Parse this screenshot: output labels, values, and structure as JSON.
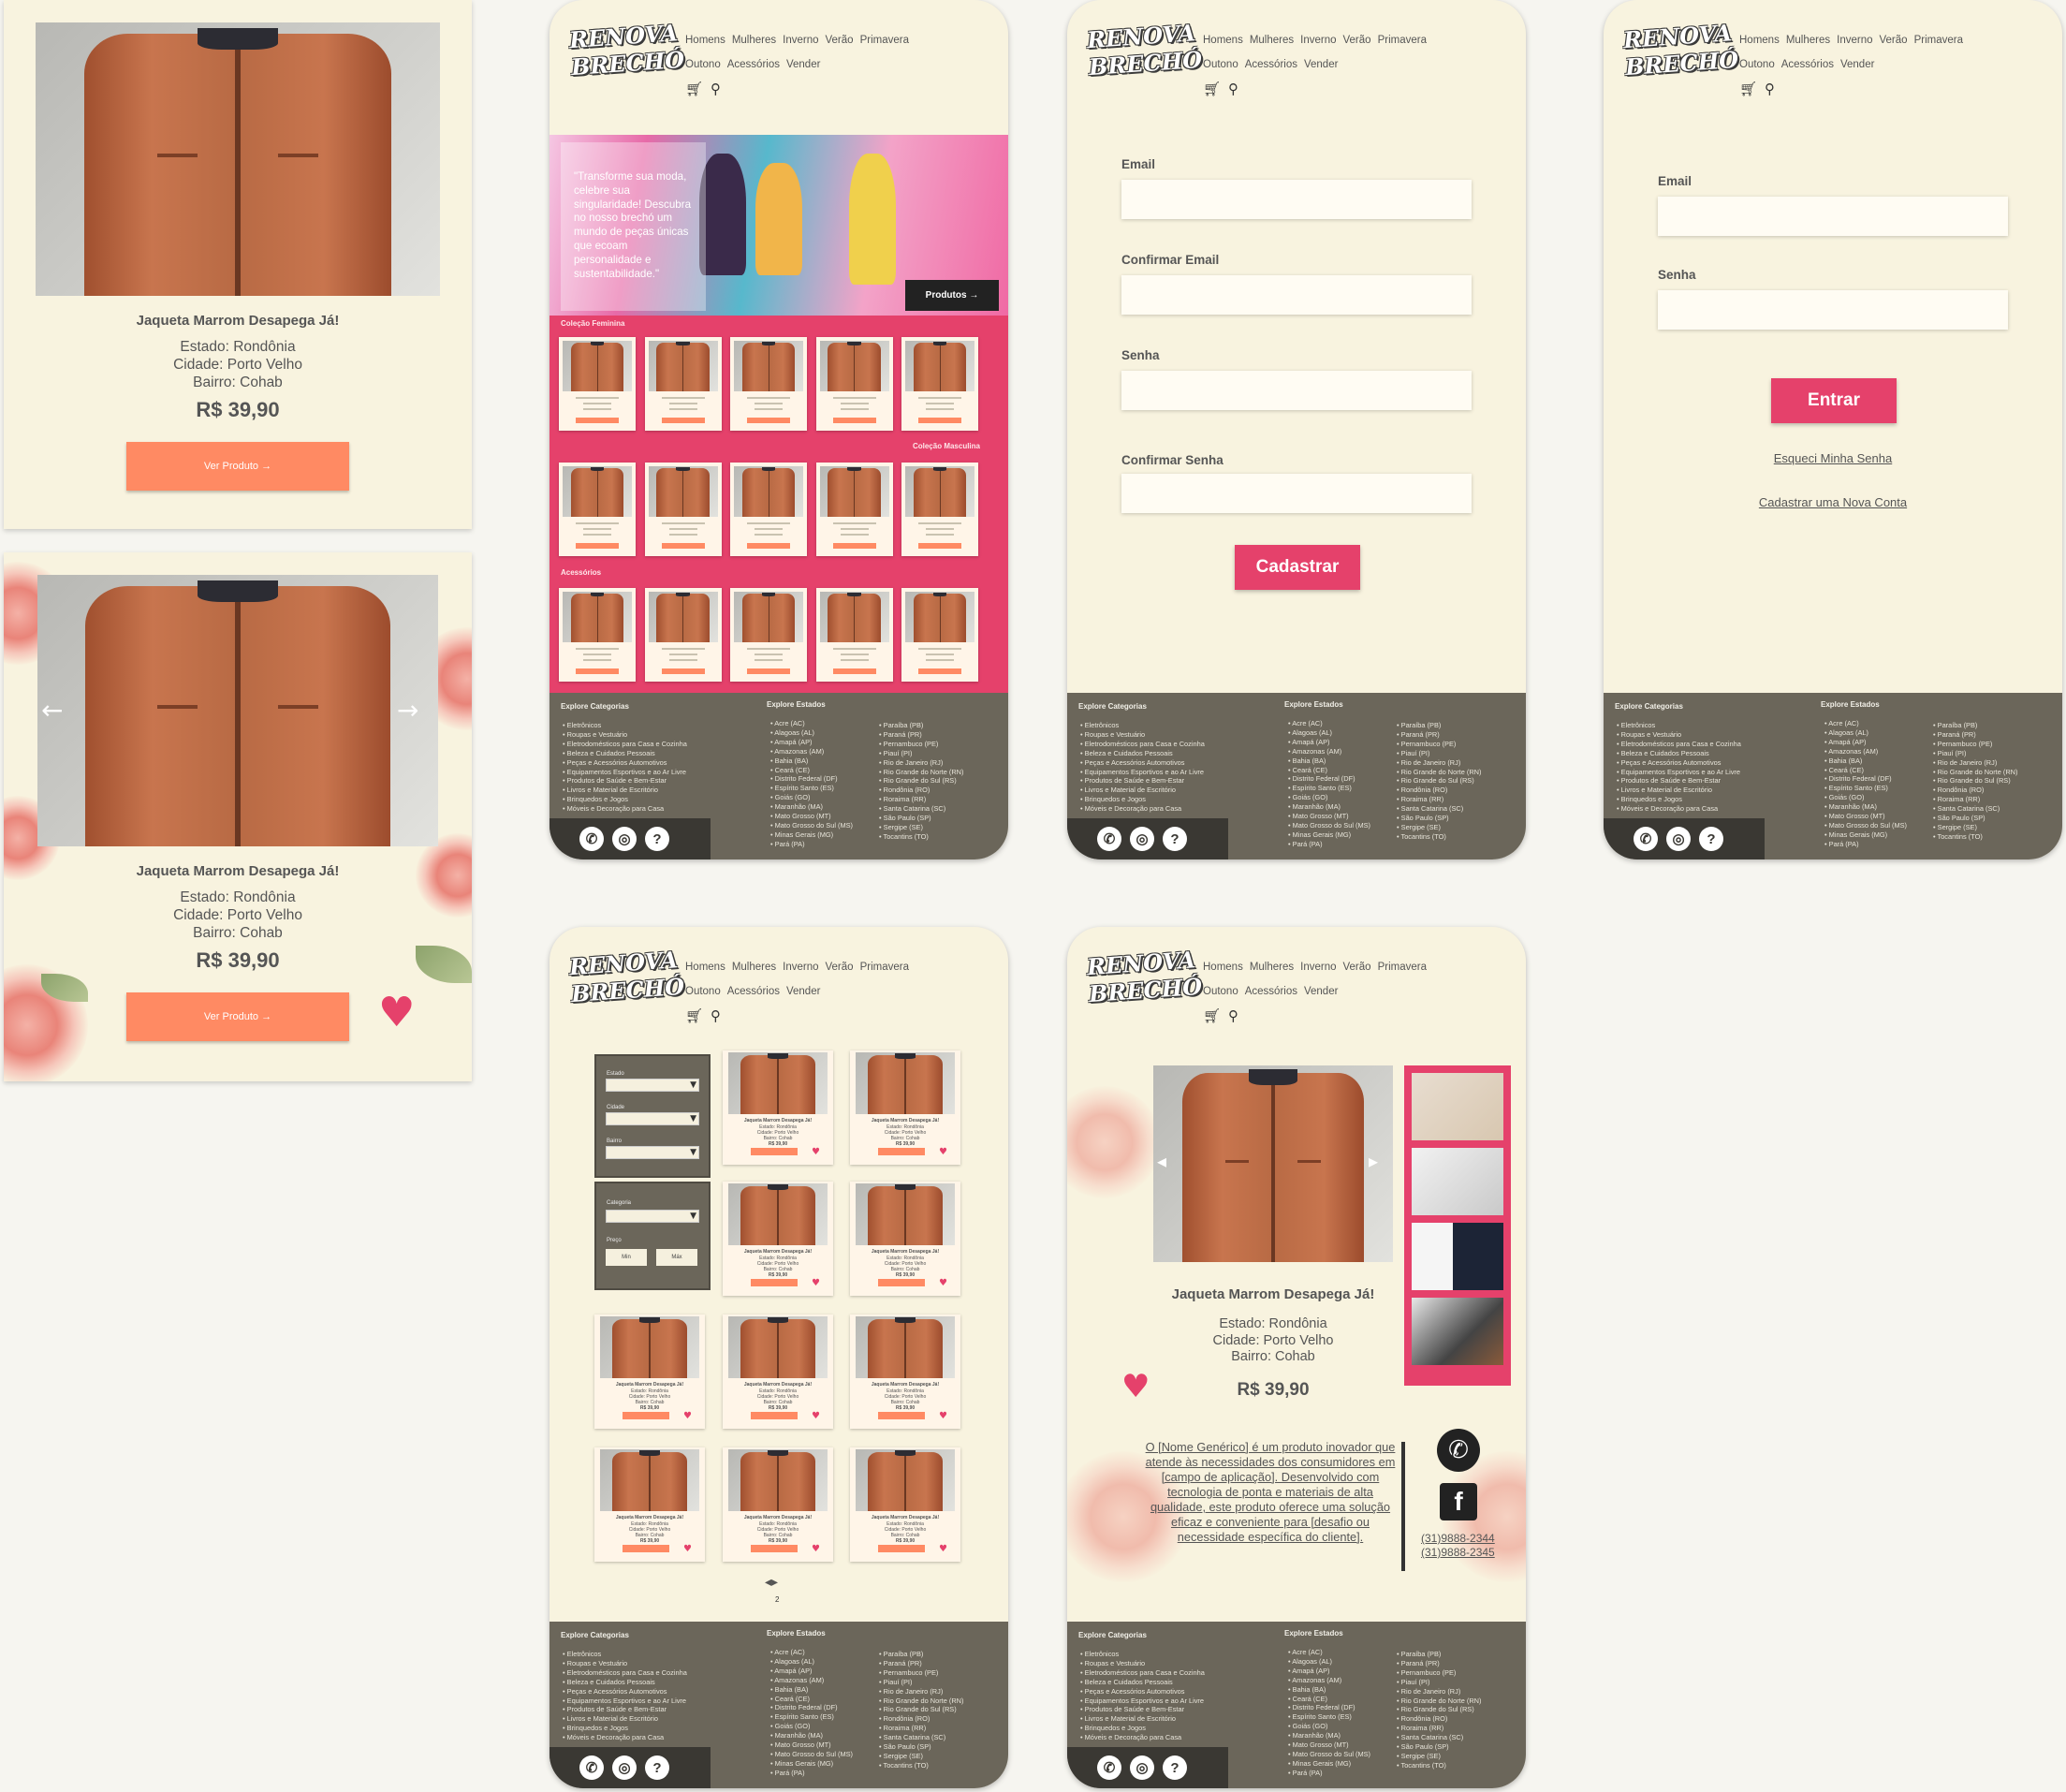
{
  "product": {
    "title": "Jaqueta Marrom Desapega Já!",
    "estado": "Estado: Rondônia",
    "cidade": "Cidade: Porto Velho",
    "bairro": "Bairro: Cohab",
    "price": "R$ 39,90",
    "view_button": "Ver Produto →",
    "description": "O [Nome Genérico] é um produto inovador que atende às necessidades dos consumidores em [campo de aplicação]. Desenvolvido com tecnologia de ponta e materiais de alta qualidade, este produto oferece uma solução eficaz e conveniente para [desafio ou necessidade específica do cliente].",
    "phone1": "(31)9888-2344",
    "phone2": "(31)9888-2345"
  },
  "brand": {
    "line1": "RENOVA",
    "line2": "BRECHÓ"
  },
  "nav": {
    "row1": [
      "Homens",
      "Mulheres",
      "Inverno",
      "Verão",
      "Primavera"
    ],
    "row2": [
      "Outono",
      "Acessórios",
      "Vender"
    ]
  },
  "hero": {
    "quote": "\"Transforme sua moda, celebre sua singularidade! Descubra no nosso brechó um mundo de peças únicas que ecoam personalidade e sustentabilidade.\"",
    "button": "Produtos →"
  },
  "sections": {
    "feminina": "Coleção Feminina",
    "masculina": "Coleção Masculina",
    "acessorios": "Acessórios"
  },
  "register": {
    "email": "Email",
    "confirm_email": "Confirmar Email",
    "password": "Senha",
    "confirm_password": "Confirmar Senha",
    "submit": "Cadastrar"
  },
  "login": {
    "email": "Email",
    "password": "Senha",
    "submit": "Entrar",
    "forgot": "Esqueci Minha Senha",
    "create": "Cadastrar uma Nova Conta"
  },
  "filters": {
    "estado": "Estado",
    "cidade": "Cidade",
    "bairro": "Bairro",
    "categoria": "Categoria",
    "preco": "Preço",
    "min": "Min",
    "max": "Máx"
  },
  "pagination": {
    "page": "2"
  },
  "footer": {
    "categories_title": "Explore Categorias",
    "states_title": "Explore Estados",
    "categories": [
      "Eletrônicos",
      "Roupas e Vestuário",
      "Eletrodomésticos para Casa e Cozinha",
      "Beleza e Cuidados Pessoais",
      "Peças e Acessórios Automotivos",
      "Equipamentos Esportivos e ao Ar Livre",
      "Produtos de Saúde e Bem-Estar",
      "Livros e Material de Escritório",
      "Brinquedos e Jogos",
      "Móveis e Decoração para Casa"
    ],
    "states_a": [
      "Acre (AC)",
      "Alagoas (AL)",
      "Amapá (AP)",
      "Amazonas (AM)",
      "Bahia (BA)",
      "Ceará (CE)",
      "Distrito Federal (DF)",
      "Espírito Santo (ES)",
      "Goiás (GO)",
      "Maranhão (MA)",
      "Mato Grosso (MT)",
      "Mato Grosso do Sul (MS)",
      "Minas Gerais (MG)",
      "Pará (PA)"
    ],
    "states_b": [
      "Paraíba (PB)",
      "Paraná (PR)",
      "Pernambuco (PE)",
      "Piauí (PI)",
      "Rio de Janeiro (RJ)",
      "Rio Grande do Norte (RN)",
      "Rio Grande do Sul (RS)",
      "Rondônia (RO)",
      "Roraima (RR)",
      "Santa Catarina (SC)",
      "São Paulo (SP)",
      "Sergipe (SE)",
      "Tocantins (TO)"
    ]
  },
  "icons": {
    "cart": "cart-icon",
    "search": "search-icon",
    "whatsapp": "whatsapp-icon",
    "instagram": "instagram-icon",
    "help": "help-icon",
    "heart": "heart-icon",
    "facebook": "facebook-icon"
  },
  "colors": {
    "cream": "#f8f3df",
    "pink": "#e5416b",
    "orange": "#ff8a63",
    "footer": "#6b665a"
  }
}
